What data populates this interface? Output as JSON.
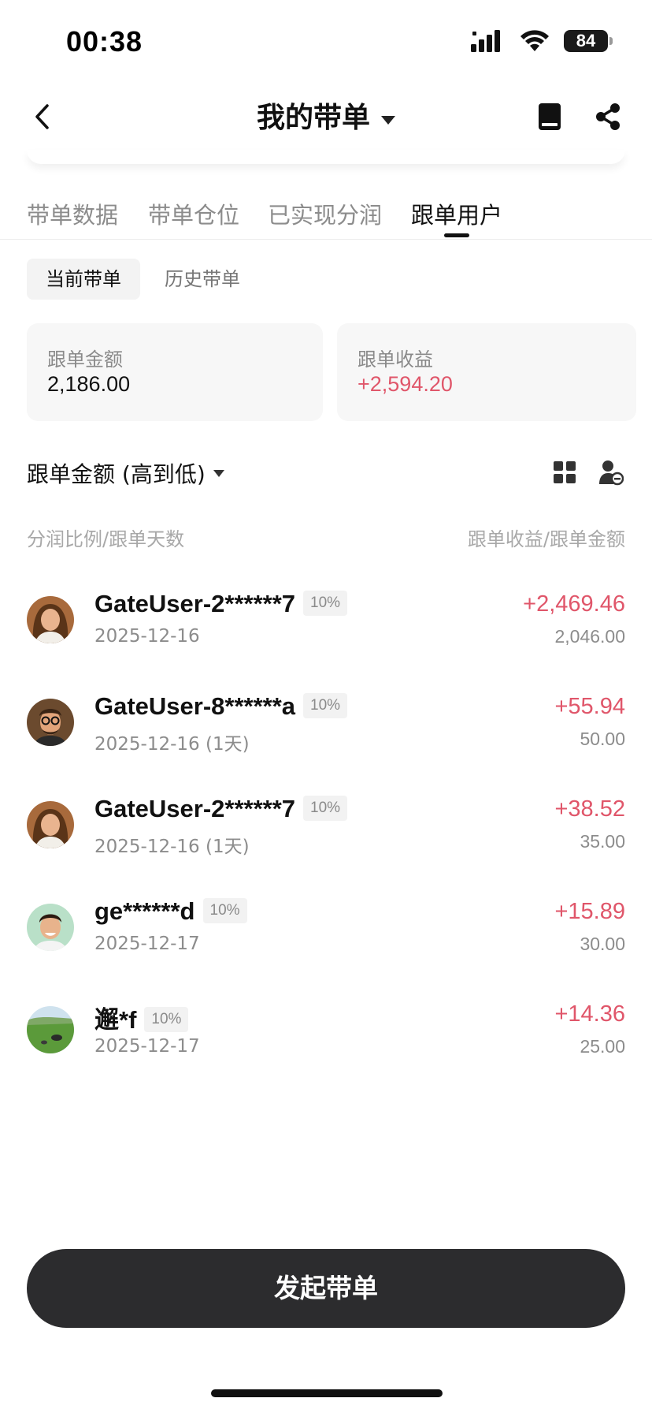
{
  "status_bar": {
    "time": "00:38",
    "battery": "84"
  },
  "nav": {
    "title": "我的带单"
  },
  "tabs": [
    {
      "label": "带单数据",
      "active": false
    },
    {
      "label": "带单仓位",
      "active": false
    },
    {
      "label": "已实现分润",
      "active": false
    },
    {
      "label": "跟单用户",
      "active": true
    }
  ],
  "segments": {
    "current": "当前带单",
    "history": "历史带单"
  },
  "summary": {
    "amount_label": "跟单金额",
    "amount_value": "2,186.00",
    "profit_label": "跟单收益",
    "profit_value": "+2,594.20"
  },
  "sort": {
    "label": "跟单金额 (高到低)"
  },
  "columns": {
    "left": "分润比例/跟单天数",
    "right": "跟单收益/跟单金额"
  },
  "users": [
    {
      "name": "GateUser-2******7",
      "ratio": "10%",
      "date": "2025-12-16",
      "profit": "+2,469.46",
      "amount": "2,046.00",
      "avatar": "woman-avatar"
    },
    {
      "name": "GateUser-8******a",
      "ratio": "10%",
      "date": "2025-12-16 (1天)",
      "profit": "+55.94",
      "amount": "50.00",
      "avatar": "man-glasses-avatar"
    },
    {
      "name": "GateUser-2******7",
      "ratio": "10%",
      "date": "2025-12-16 (1天)",
      "profit": "+38.52",
      "amount": "35.00",
      "avatar": "woman-avatar"
    },
    {
      "name": "ge******d",
      "ratio": "10%",
      "date": "2025-12-17",
      "profit": "+15.89",
      "amount": "30.00",
      "avatar": "man-smile-avatar"
    },
    {
      "name": "邂*f",
      "ratio": "10%",
      "date": "2025-12-17",
      "profit": "+14.36",
      "amount": "25.00",
      "avatar": "landscape-avatar"
    }
  ],
  "cta": {
    "label": "发起带单"
  },
  "colors": {
    "accent_red": "#e0566a",
    "cta_bg": "#2c2c2e",
    "muted": "#8c8c8c"
  }
}
